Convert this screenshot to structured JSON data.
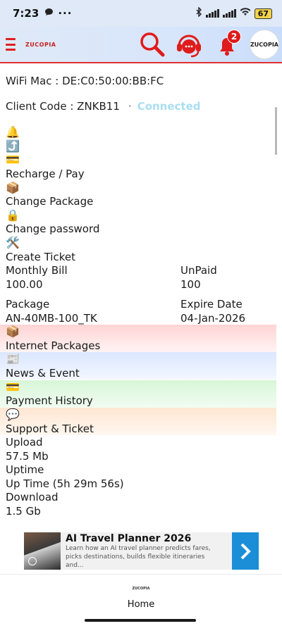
{
  "status_bar": {
    "time": "7:23",
    "battery": "67"
  },
  "header": {
    "brand": "ZUCOPIA",
    "notification_count": "2",
    "profile_label": "ZUCOPIA"
  },
  "wifi": {
    "label": "WiFi Mac : DE:C0:50:00:BB:FC"
  },
  "client": {
    "label": "Client Code : ZNKB11",
    "separator": "·",
    "status": "Connected"
  },
  "menu": [
    {
      "icon": "🔔",
      "label": ""
    },
    {
      "icon": "⤴️",
      "label": ""
    },
    {
      "icon": "💳",
      "label": "Recharge / Pay"
    },
    {
      "icon": "📦",
      "label": "Change Package"
    },
    {
      "icon": "🔒",
      "label": "Change password"
    },
    {
      "icon": "🛠️",
      "label": "Create Ticket"
    }
  ],
  "bill": {
    "label": "Monthly Bill",
    "amount": "100.00",
    "status_label": "UnPaid",
    "status_value": "100"
  },
  "package": {
    "label": "Package",
    "value": "AN-40MB-100_TK",
    "expire_label": "Expire Date",
    "expire_value": "04-Jan-2026"
  },
  "sections": [
    {
      "icon": "📦",
      "label": "Internet Packages",
      "color": "#ffd4d4"
    },
    {
      "icon": "📰",
      "label": "News & Event",
      "color": "#dbe7ff"
    },
    {
      "icon": "💳",
      "label": "Payment History",
      "color": "#d7f6d7"
    },
    {
      "icon": "💬",
      "label": "Support & Ticket",
      "color": "#ffe6d3"
    }
  ],
  "usage": {
    "upload_label": "Upload",
    "upload_value": "57.5 Mb",
    "uptime_label": "Uptime",
    "uptime_value": "Up Time (5h 29m 56s)",
    "download_label": "Download",
    "download_value": "1.5 Gb"
  },
  "ad": {
    "title": "AI Travel Planner 2026",
    "description": "Learn how an AI travel planner predicts fares, picks destinations, builds flexible itineraries and..."
  },
  "bottom_nav": {
    "logo": "ZUCOPIA",
    "home_label": "Home"
  }
}
